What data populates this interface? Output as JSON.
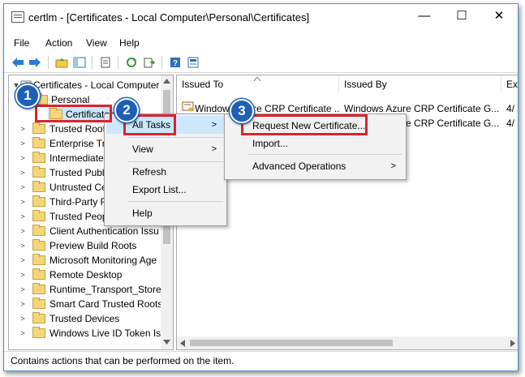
{
  "window": {
    "title": "certlm - [Certificates - Local Computer\\Personal\\Certificates]",
    "minimize_glyph": "—",
    "maximize_glyph": "☐",
    "close_glyph": "✕"
  },
  "menubar": [
    "File",
    "Action",
    "View",
    "Help"
  ],
  "toolbar_icons": [
    "back-icon",
    "forward-icon",
    "up-folder-icon",
    "show-tree-icon",
    "copy-icon",
    "refresh-icon",
    "export-icon",
    "help-icon",
    "properties-icon"
  ],
  "tree": {
    "root": "Certificates - Local Computer",
    "personal": "Personal",
    "certificates": "Certificates",
    "items": [
      "Trusted Root",
      "Enterprise Tru",
      "Intermediate",
      "Trusted Publis",
      "Untrusted Cer",
      "Third-Party R",
      "Trusted Peopl",
      "Client Authentication Issu",
      "Preview Build Roots",
      "Microsoft Monitoring Age",
      "Remote Desktop",
      "Runtime_Transport_Store_",
      "Smart Card Trusted Roots",
      "Trusted Devices",
      "Windows Live ID Token Iss"
    ]
  },
  "list": {
    "columns": [
      "Issued To",
      "Issued By",
      "Ex"
    ],
    "rows": [
      {
        "issued_to": "Windows Azure CRP Certificate ...",
        "issued_by": "Windows Azure CRP Certificate G...",
        "expires": "4/"
      },
      {
        "issued_to": "",
        "issued_by": "Windows Azure CRP Certificate G...",
        "expires": "4/"
      }
    ]
  },
  "context_menu": {
    "all_tasks": "All Tasks",
    "view": "View",
    "refresh": "Refresh",
    "export_list": "Export List...",
    "help": "Help"
  },
  "submenu": {
    "request_new": "Request New Certificate...",
    "import": "Import...",
    "advanced": "Advanced Operations"
  },
  "badges": [
    "1",
    "2",
    "3"
  ],
  "status": "Contains actions that can be performed on the item.",
  "colors": {
    "highlight": "#d9242f",
    "badge": "#1f5fb8",
    "menu_bg": "#f2f2f2"
  }
}
